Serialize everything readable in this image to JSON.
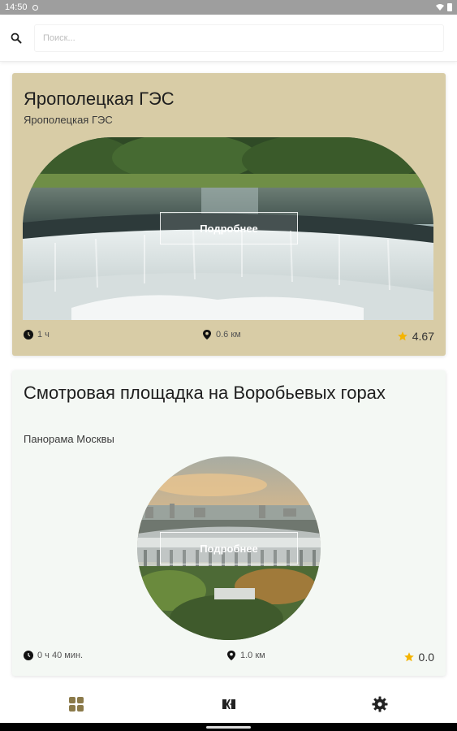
{
  "status_bar": {
    "time": "14:50"
  },
  "search": {
    "placeholder": "Поиск..."
  },
  "cards": [
    {
      "title": "Ярополецкая ГЭС",
      "subtitle": "Ярополецкая ГЭС",
      "image_shape": "arch",
      "details_label": "Подробнее",
      "duration": "1 ч",
      "distance": "0.6 км",
      "rating": "4.67",
      "background": "#d8cca6"
    },
    {
      "title": "Смотровая площадка на Воробьевых горах",
      "subtitle": "Панорама Москвы",
      "image_shape": "circle",
      "details_label": "Подробнее",
      "duration": "0 ч 40 мин.",
      "distance": "1.0 км",
      "rating": "0.0",
      "background": "#f4f8f4"
    }
  ],
  "bottom_nav": {
    "items": [
      {
        "icon": "grid-icon",
        "active": true
      },
      {
        "icon": "app-logo-icon",
        "active": false
      },
      {
        "icon": "gear-icon",
        "active": false
      }
    ]
  },
  "colors": {
    "accent": "#8b7a4a",
    "star": "#f4b400",
    "icon_dark": "#222222"
  }
}
